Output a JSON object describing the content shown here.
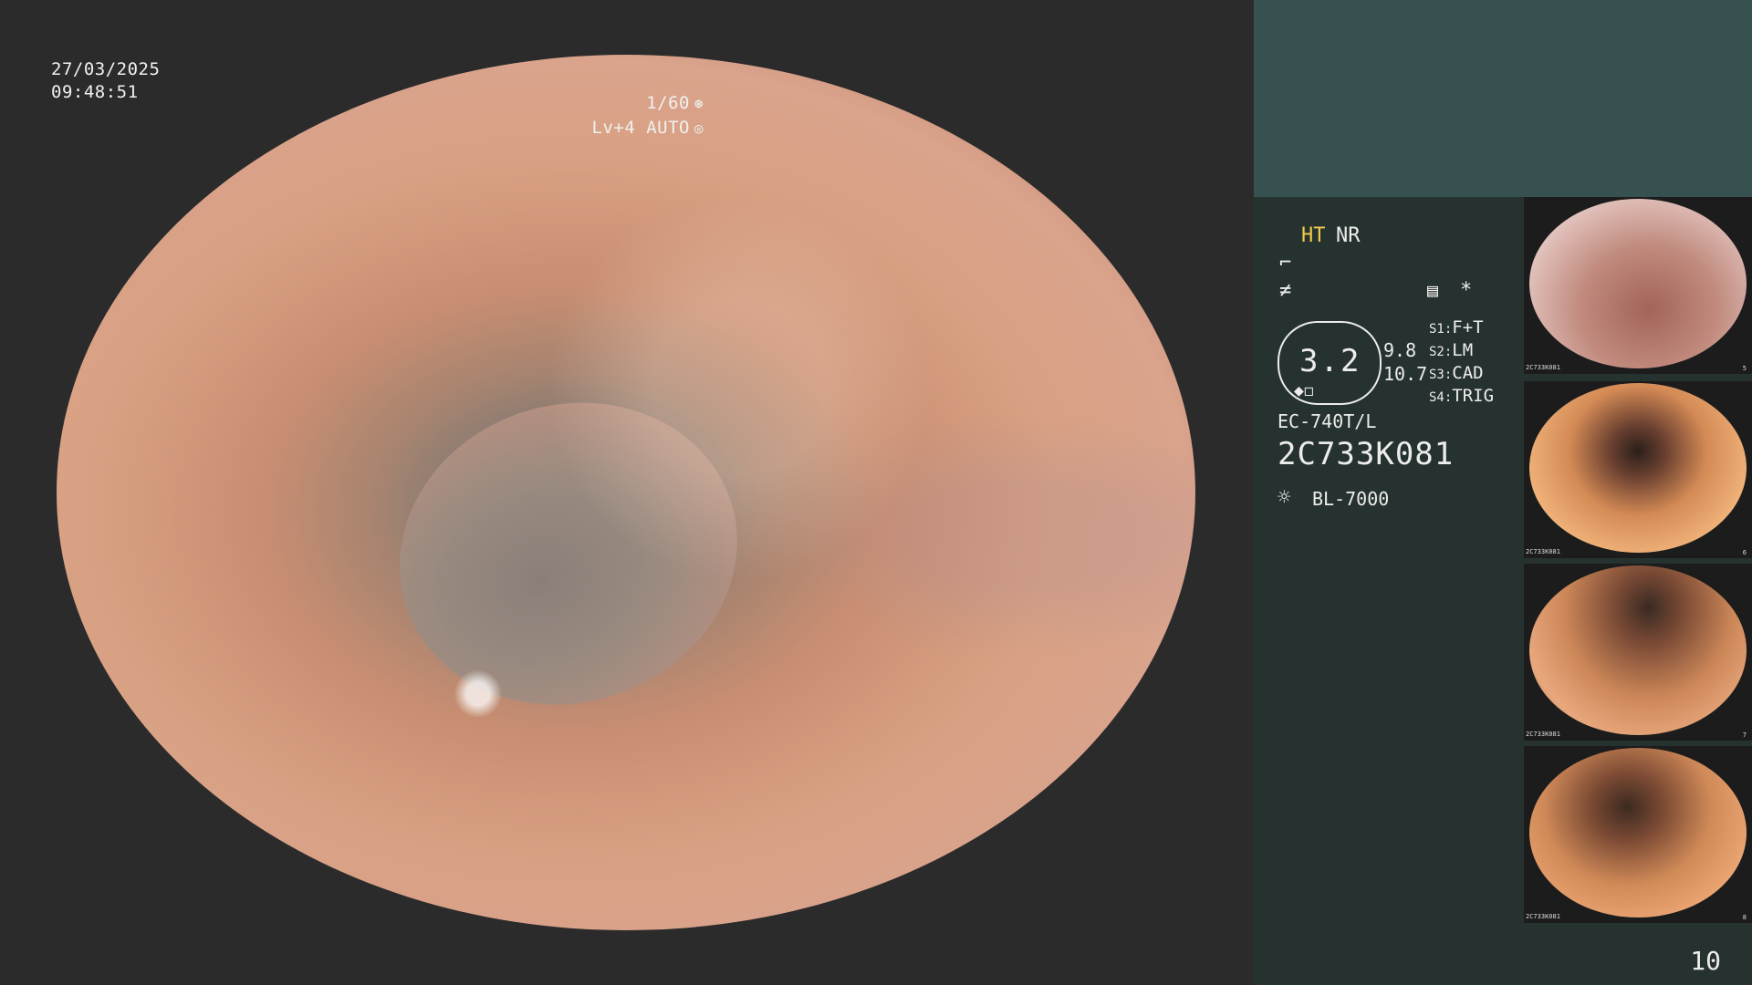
{
  "overlay": {
    "date": "27/03/2025",
    "time": "09:48:51",
    "shutter": "1/60",
    "shutter_icon": "aperture-icon",
    "level": "Lv+4 AUTO",
    "level_icon": "auto-iris-icon"
  },
  "panel": {
    "mode_ht": "HT",
    "mode_nr": "NR",
    "mode_ht_color": "#f2c94c",
    "icon_a": "enhancement-icon",
    "icon_b": "freeze-icon",
    "icon_c": "settings-icon",
    "icon_d": "asterisk-icon",
    "zoom_value": "3.2",
    "value_1": "9.8",
    "value_2": "10.7",
    "switches": [
      {
        "key": "S1:",
        "label": "F+T"
      },
      {
        "key": "S2:",
        "label": "LM"
      },
      {
        "key": "S3:",
        "label": "CAD"
      },
      {
        "key": "S4:",
        "label": "TRIG"
      }
    ],
    "scope_model": "EC-740T/L",
    "scope_serial": "2C733K081",
    "light_source_icon": "light-source-icon",
    "light_source": "BL-7000",
    "page_number": "10"
  },
  "thumbnails": [
    {
      "serial": "2C733K081",
      "index": "5"
    },
    {
      "serial": "2C733K081",
      "index": "6"
    },
    {
      "serial": "2C733K081",
      "index": "7"
    },
    {
      "serial": "2C733K081",
      "index": "8"
    }
  ]
}
